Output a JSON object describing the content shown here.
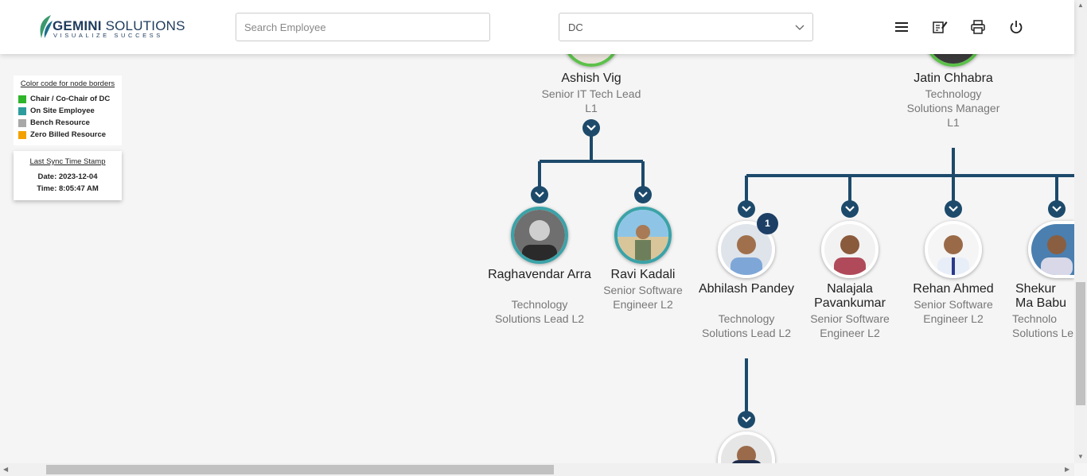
{
  "header": {
    "logo_main": "GEMINI",
    "logo_second": "SOLUTIONS",
    "logo_tagline": "VISUALIZE SUCCESS",
    "search_placeholder": "Search Employee",
    "dc_select_value": "DC",
    "icons": [
      "menu-icon",
      "edit-note-icon",
      "print-icon",
      "power-icon"
    ]
  },
  "legend": {
    "title": "Color code for node borders",
    "items": [
      {
        "label": "Chair / Co-Chair of DC",
        "color": "#2fb52a"
      },
      {
        "label": "On Site Employee",
        "color": "#2d9c9c"
      },
      {
        "label": "Bench Resource",
        "color": "#a8a8a8"
      },
      {
        "label": "Zero Billed Resource",
        "color": "#f2a100"
      }
    ]
  },
  "sync": {
    "title": "Last Sync Time Stamp",
    "date": "Date: 2023-12-04",
    "time": "Time: 8:05:47 AM"
  },
  "nodes": {
    "ashish": {
      "name": "Ashish Vig",
      "title": "Senior IT Tech Lead L1"
    },
    "jatin": {
      "name": "Jatin Chhabra",
      "title": "Technology Solutions Manager L1"
    },
    "raghavendar": {
      "name": "Raghavendar Arra",
      "title": "Technology Solutions Lead L2"
    },
    "ravi": {
      "name": "Ravi Kadali",
      "title": "Senior Software Engineer L2"
    },
    "abhilash": {
      "name": "Abhilash Pandey",
      "title": "Technology Solutions Lead L2",
      "badge": "1"
    },
    "nalajala": {
      "name": "Nalajala Pavankumar",
      "title": "Senior Software Engineer L2"
    },
    "rehan": {
      "name": "Rehan Ahmed",
      "title": "Senior Software Engineer L2"
    },
    "shekur": {
      "name": "Shekur Ma Babu",
      "title": "Technolo Solutions Le"
    }
  },
  "colors": {
    "connector": "#1d4a6b",
    "onsite_border": "#3aa3a8",
    "chair_border": "#5cc14a"
  }
}
